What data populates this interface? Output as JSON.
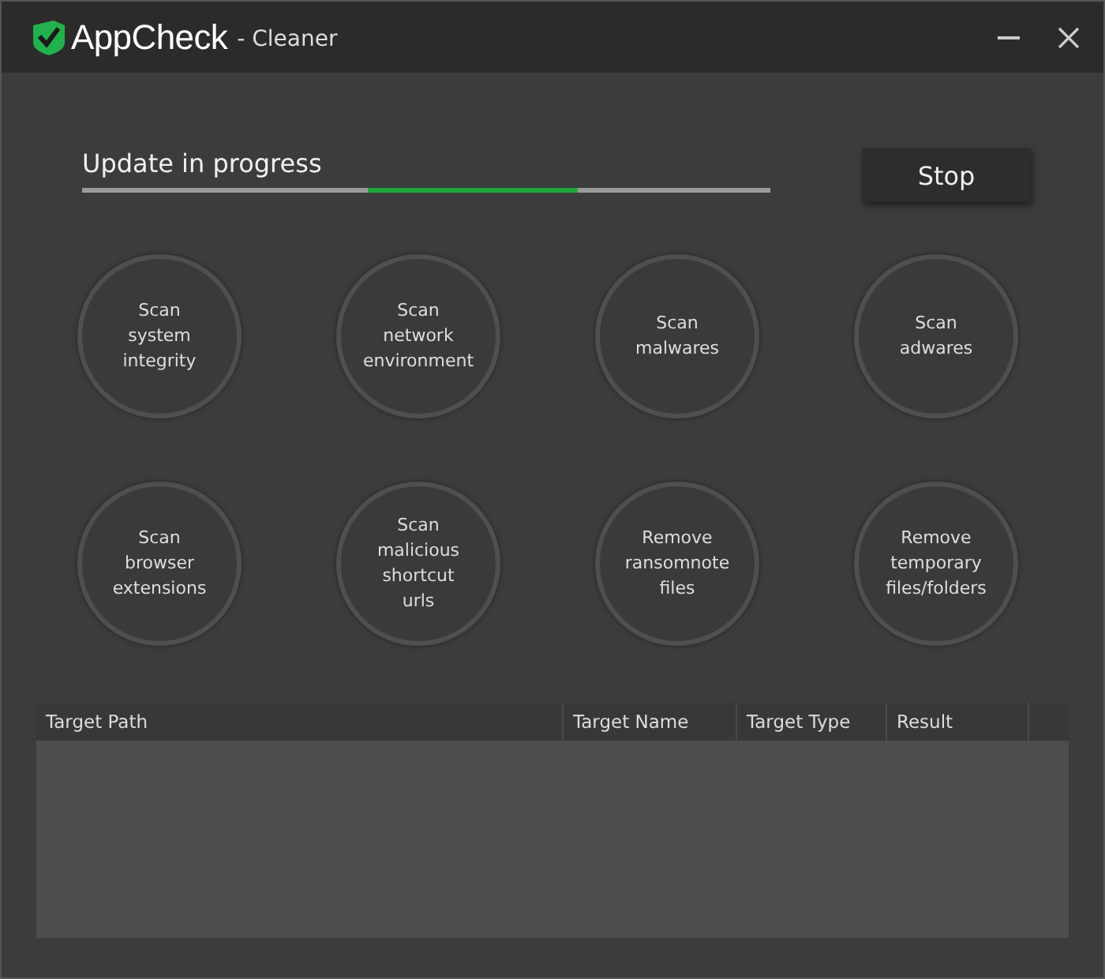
{
  "window": {
    "app_name": "AppCheck",
    "subtitle": "- Cleaner"
  },
  "progress": {
    "label": "Update in progress",
    "indeterminate": true
  },
  "stop_button": "Stop",
  "actions": [
    {
      "label": "Scan\nsystem\nintegrity"
    },
    {
      "label": "Scan\nnetwork\nenvironment"
    },
    {
      "label": "Scan\nmalwares"
    },
    {
      "label": "Scan\nadwares"
    },
    {
      "label": "Scan\nbrowser\nextensions"
    },
    {
      "label": "Scan\nmalicious\nshortcut\nurls"
    },
    {
      "label": "Remove\nransomnote\nfiles"
    },
    {
      "label": "Remove\ntemporary\nfiles/folders"
    }
  ],
  "table": {
    "columns": [
      "Target Path",
      "Target Name",
      "Target Type",
      "Result"
    ]
  }
}
